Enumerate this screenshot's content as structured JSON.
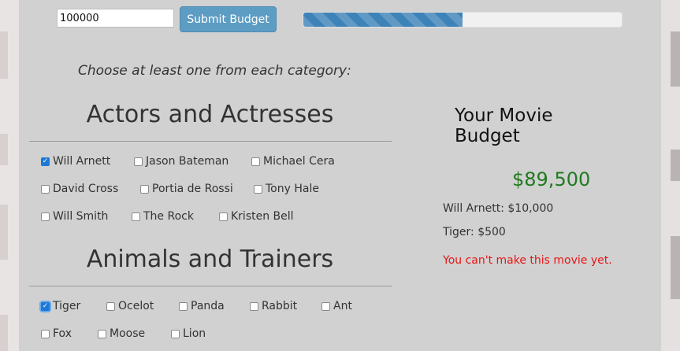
{
  "budget_form": {
    "input_value": "100000",
    "submit_label": "Submit Budget",
    "progress_fraction": 0.5
  },
  "instructions": "Choose at least one from each category:",
  "categories": [
    {
      "title": "Actors and Actresses",
      "items": [
        {
          "label": "Will Arnett",
          "checked": true
        },
        {
          "label": "Jason Bateman",
          "checked": false
        },
        {
          "label": "Michael Cera",
          "checked": false
        },
        {
          "label": "David Cross",
          "checked": false
        },
        {
          "label": "Portia de Rossi",
          "checked": false
        },
        {
          "label": "Tony Hale",
          "checked": false
        },
        {
          "label": "Will Smith",
          "checked": false
        },
        {
          "label": "The Rock",
          "checked": false
        },
        {
          "label": "Kristen Bell",
          "checked": false
        }
      ]
    },
    {
      "title": "Animals and Trainers",
      "items": [
        {
          "label": "Tiger",
          "checked": true
        },
        {
          "label": "Ocelot",
          "checked": false
        },
        {
          "label": "Panda",
          "checked": false
        },
        {
          "label": "Rabbit",
          "checked": false
        },
        {
          "label": "Ant",
          "checked": false
        },
        {
          "label": "Fox",
          "checked": false
        },
        {
          "label": "Moose",
          "checked": false
        },
        {
          "label": "Lion",
          "checked": false
        }
      ]
    }
  ],
  "summary": {
    "title": "Your Movie Budget",
    "total": "$89,500",
    "line_items": [
      "Will Arnett: $10,000",
      "Tiger: $500"
    ],
    "warning": "You can't make this movie yet."
  },
  "colors": {
    "button": "#5d9cc3",
    "progress_fill": "#3e83b8",
    "total_text": "#1f7a1f",
    "warning_text": "#e81414"
  }
}
